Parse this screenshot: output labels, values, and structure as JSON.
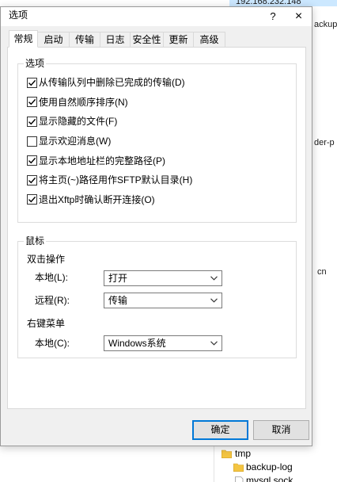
{
  "colors": {
    "accent": "#0078d7",
    "selection": "#cce8ff",
    "folder": "#f4c542"
  },
  "background": {
    "host_label": "192.168.232.148",
    "side_labels": [
      "ackup-",
      "der-p",
      "cn"
    ],
    "tree": [
      {
        "label": "tmp",
        "icon": "folder-icon"
      },
      {
        "label": "backup-log",
        "icon": "folder-icon"
      },
      {
        "label": "mysql.sock",
        "icon": "file-icon"
      }
    ]
  },
  "dialog": {
    "title": "选项",
    "help_label": "?",
    "close_label": "×",
    "check_icon": "checkmark-icon",
    "select_icon": "chevron-down-icon",
    "tabs": [
      {
        "label": "常规",
        "active": true
      },
      {
        "label": "启动",
        "active": false
      },
      {
        "label": "传输",
        "active": false
      },
      {
        "label": "日志",
        "active": false
      },
      {
        "label": "安全性",
        "active": false
      },
      {
        "label": "更新",
        "active": false
      },
      {
        "label": "高级",
        "active": false
      }
    ],
    "options_group": {
      "label": "选项",
      "items": [
        {
          "label": "从传输队列中删除已完成的传输(D)",
          "checked": true
        },
        {
          "label": "使用自然顺序排序(N)",
          "checked": true
        },
        {
          "label": "显示隐藏的文件(F)",
          "checked": true
        },
        {
          "label": "显示欢迎消息(W)",
          "checked": false
        },
        {
          "label": "显示本地地址栏的完整路径(P)",
          "checked": true
        },
        {
          "label": "将主页(~)路径用作SFTP默认目录(H)",
          "checked": true
        },
        {
          "label": "退出Xftp时确认断开连接(O)",
          "checked": true
        }
      ]
    },
    "mouse_group": {
      "label": "鼠标",
      "double_click": {
        "heading": "双击操作",
        "local": {
          "label": "本地(L):",
          "value": "打开"
        },
        "remote": {
          "label": "远程(R):",
          "value": "传输"
        }
      },
      "right_click": {
        "heading": "右键菜单",
        "local": {
          "label": "本地(C):",
          "value": "Windows系统"
        }
      }
    },
    "buttons": {
      "ok": "确定",
      "cancel": "取消"
    }
  }
}
